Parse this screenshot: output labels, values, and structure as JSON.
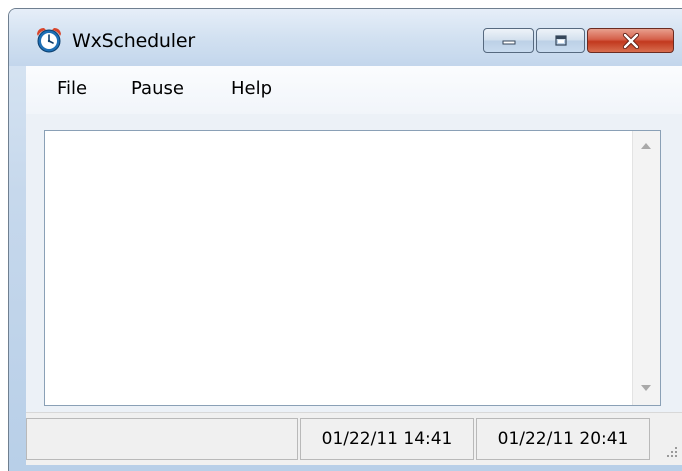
{
  "window": {
    "title": "WxScheduler",
    "icon": "alarm-clock-icon",
    "controls": [
      "minimize-icon",
      "maximize-icon",
      "close-icon"
    ]
  },
  "menu": {
    "items": [
      {
        "label": "File"
      },
      {
        "label": "Pause"
      },
      {
        "label": "Help"
      }
    ]
  },
  "log": {
    "content": ""
  },
  "statusbar": {
    "message": "",
    "start_time": "01/22/11 14:41",
    "next_time": "01/22/11 20:41"
  },
  "colors": {
    "close_button": "#c7402a",
    "titlebar": "#d2e1f1",
    "clock_icon": "#1e6fb5"
  }
}
